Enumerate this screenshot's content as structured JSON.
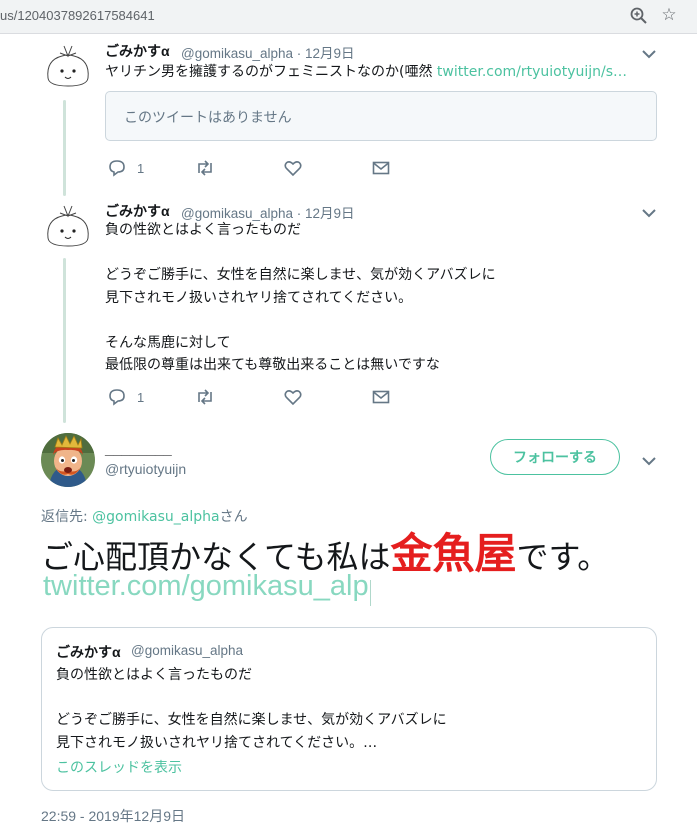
{
  "browser": {
    "url": "us/1204037892617584641",
    "zoom_icon": "zoom-icon",
    "star_icon": "bookmark-star-icon"
  },
  "tweets": [
    {
      "name": "ごみかすα",
      "handle": "@gomikasu_alpha · 12月9日",
      "text": "ヤリチン男を擁護するのがフェミニストなのか(唖然 ",
      "link": "twitter.com/rtyuiotyuijn/s…",
      "quote_unavailable": "このツイートはありません",
      "reply_count": "1"
    },
    {
      "name": "ごみかすα",
      "handle": "@gomikasu_alpha · 12月9日",
      "text": "負の性欲とはよく言ったものだ\n\nどうぞご勝手に、女性を自然に楽しませ、気が効くアバズレに\n見下されモノ扱いされヤリ捨てされてください。\n\nそんな馬鹿に対して\n最低限の尊重は出来ても尊敬出来ることは無いですな",
      "reply_count": "1"
    }
  ],
  "main_tweet": {
    "display_name": "________",
    "handle": "@rtyuiotyuijn",
    "follow_label": "フォローする",
    "reply_prefix": "返信先: ",
    "reply_user": "@gomikasu_alpha",
    "reply_suffix": "さん",
    "text_before": "ご心配頂かなくても私は",
    "text_red": "金魚屋",
    "text_after": "です。",
    "link": "twitter.com/gomikasu_alp",
    "quoted": {
      "name": "ごみかすα",
      "handle": "@gomikasu_alpha",
      "text": "負の性欲とはよく言ったものだ\n\nどうぞご勝手に、女性を自然に楽しませ、気が効くアバズレに\n見下されモノ扱いされヤリ捨てされてください。…",
      "show_thread": "このスレッドを表示"
    },
    "timestamp": "22:59 - 2019年12月9日"
  },
  "colors": {
    "accent": "#4cc2a0",
    "red_text": "#e51e1e",
    "muted": "#657786"
  }
}
